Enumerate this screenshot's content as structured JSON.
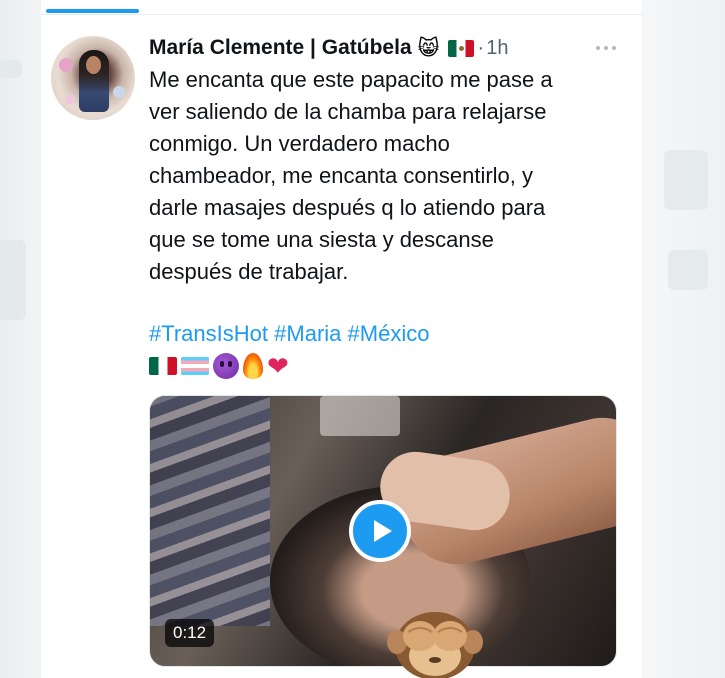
{
  "author": {
    "display_name": "María Clemente | Gatúbela",
    "name_emoji": "😸",
    "flag_icon": "mexico-flag-icon",
    "separator": "·",
    "time_ago": "1h"
  },
  "tweet": {
    "text_lines": [
      "Me encanta que este papacito me pase a",
      "ver saliendo de la chamba para relajarse",
      "conmigo. Un verdadero macho",
      "chambeador, me encanta consentirlo, y",
      "darle masajes después q lo atiendo para",
      "que se tome una siesta y descanse",
      "después de trabajar."
    ],
    "hashtags": [
      "#TransIsHot",
      "#Maria",
      "#México"
    ],
    "emoji_icons": [
      "mexico-flag-icon",
      "transgender-flag-icon",
      "devil-face-icon",
      "fire-icon",
      "red-heart-icon"
    ],
    "heart_glyph": "❤"
  },
  "media": {
    "duration": "0:12",
    "play_icon": "play-icon"
  },
  "colors": {
    "accent": "#1d9bf0",
    "text": "#0f1419",
    "muted": "#536471",
    "heart": "#e0245e"
  }
}
